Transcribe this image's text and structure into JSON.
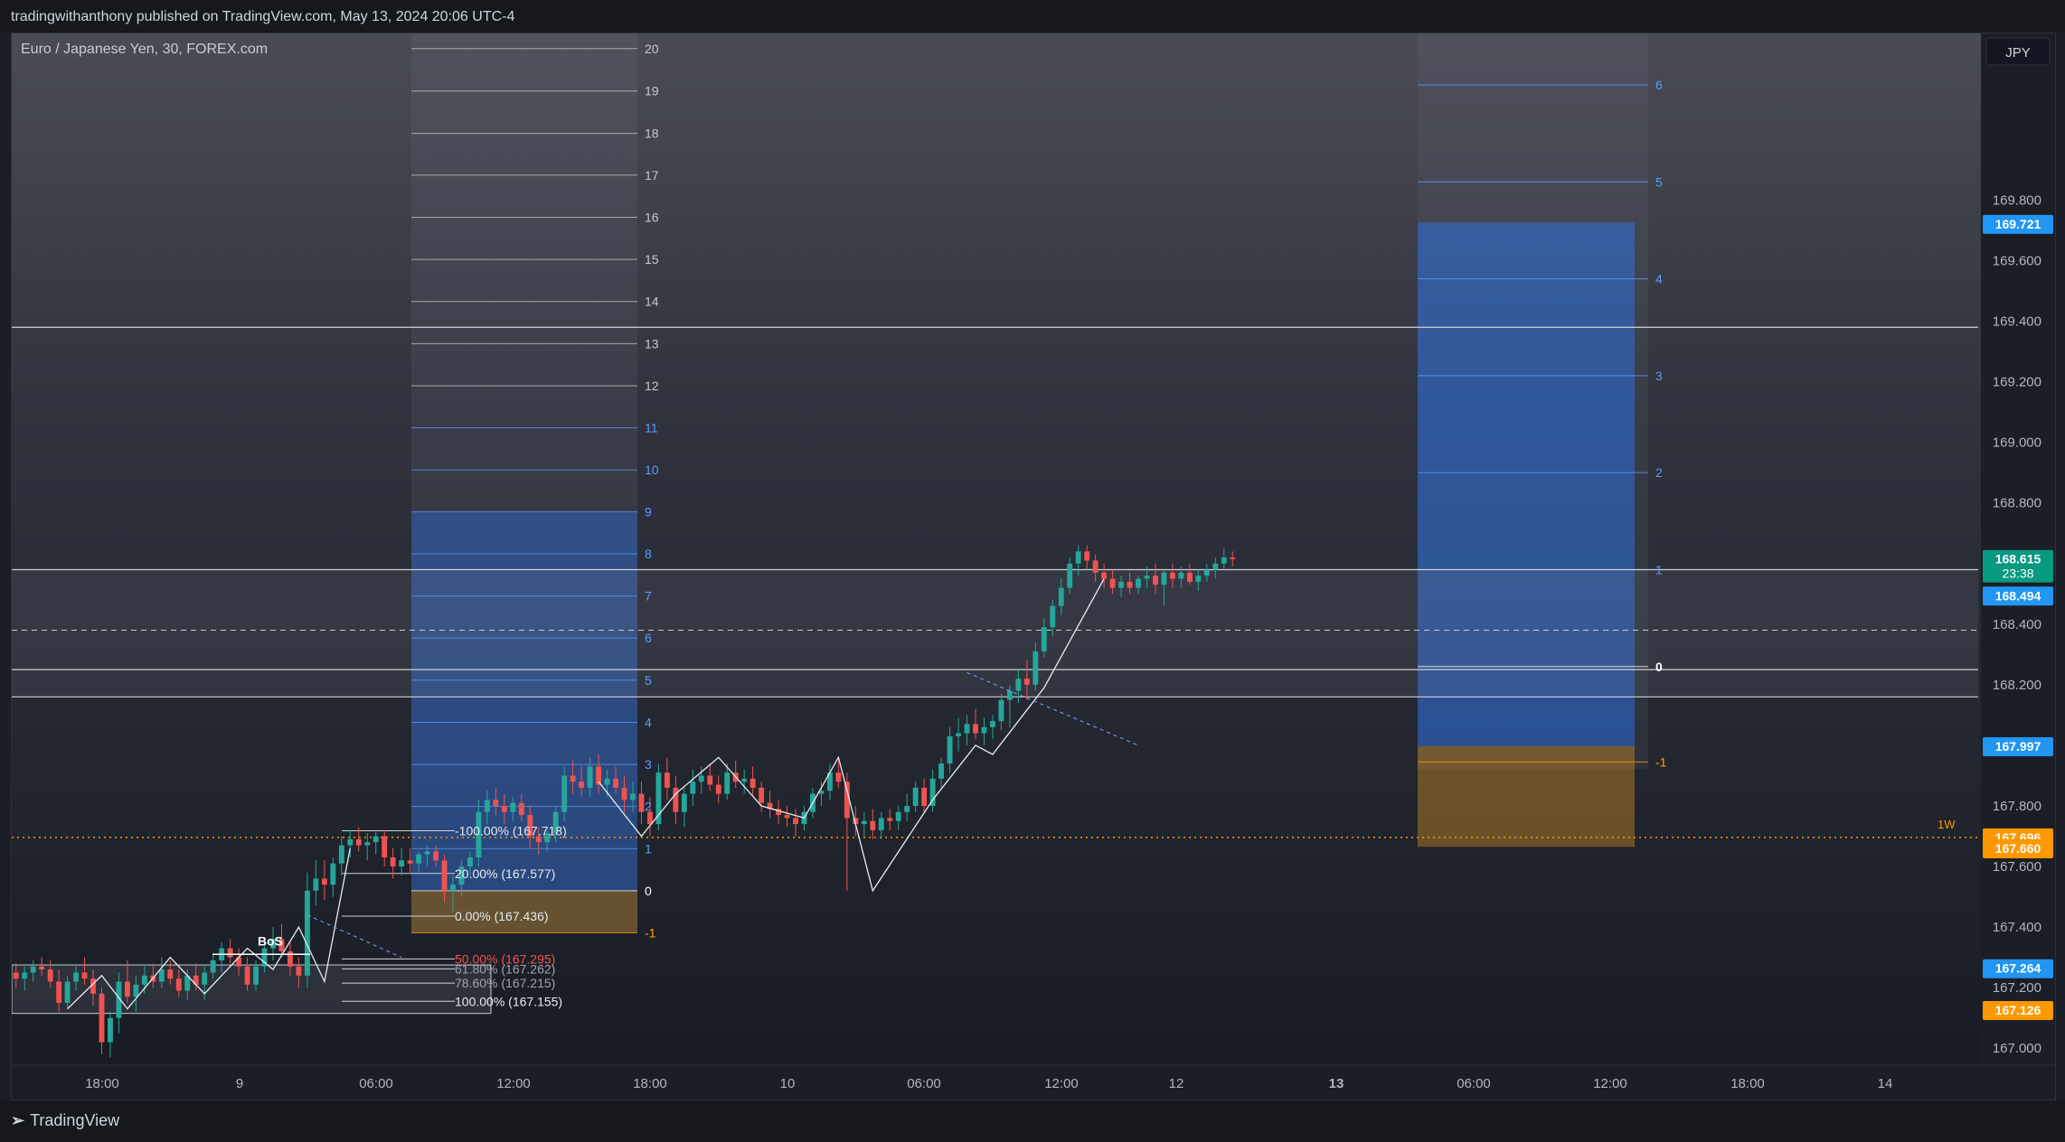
{
  "header": {
    "publish_line": "tradingwithanthony published on TradingView.com, May 13, 2024 20:06 UTC-4"
  },
  "chart_title": "Euro / Japanese Yen, 30, FOREX.com",
  "currency_button": "JPY",
  "brand": "TradingView",
  "colors": {
    "up": "#26a69a",
    "down": "#ef5350",
    "blue_zone": "#2962ff",
    "orange_zone": "#f7a600",
    "bg": "#1b1e26"
  },
  "chart_data": {
    "type": "candlestick",
    "ylim": [
      166.95,
      170.35
    ],
    "price_ticks": [
      "169.800",
      "169.600",
      "169.400",
      "169.200",
      "169.000",
      "168.800",
      "168.400",
      "168.200",
      "167.800",
      "167.600",
      "167.400",
      "167.200",
      "167.000"
    ],
    "price_tick_values": [
      169.8,
      169.6,
      169.4,
      169.2,
      169.0,
      168.8,
      168.4,
      168.2,
      167.8,
      167.6,
      167.4,
      167.2,
      167.0
    ],
    "time_ticks": [
      "18:00",
      "9",
      "06:00",
      "12:00",
      "18:00",
      "10",
      "06:00",
      "12:00",
      "12",
      "13",
      "06:00",
      "12:00",
      "18:00",
      "14"
    ],
    "bold_time_tick": "13",
    "price_badges": [
      {
        "label": "169.721",
        "value": 169.721,
        "color": "#2196f3"
      },
      {
        "label": "168.615",
        "sub": "23:38",
        "value": 168.615,
        "color": "#089981"
      },
      {
        "label": "168.494",
        "value": 168.494,
        "color": "#2196f3"
      },
      {
        "label": "167.997",
        "value": 167.997,
        "color": "#2196f3"
      },
      {
        "label": "167.696",
        "value": 167.696,
        "color": "#ff9800"
      },
      {
        "label": "167.660",
        "value": 167.66,
        "color": "#ff9800"
      },
      {
        "label": "167.264",
        "value": 167.264,
        "color": "#2196f3"
      },
      {
        "label": "167.126",
        "value": 167.126,
        "color": "#ff9800"
      }
    ],
    "horizontal_levels": [
      169.38,
      168.58,
      168.25,
      168.16
    ],
    "weekly_level": {
      "label": "1W",
      "value": 167.696
    },
    "dashed_level": 168.38,
    "left_grid_labels": [
      "20",
      "19",
      "18",
      "17",
      "16",
      "15",
      "14",
      "13",
      "12",
      "11",
      "10",
      "9",
      "8",
      "7",
      "6",
      "5",
      "4",
      "3",
      "2",
      "1",
      "0",
      "-1"
    ],
    "left_grid_prices": [
      170.3,
      170.16,
      170.02,
      169.882,
      169.743,
      169.604,
      169.465,
      169.326,
      169.187,
      169.048,
      168.909,
      168.771,
      168.632,
      168.493,
      168.354,
      168.215,
      168.076,
      167.937,
      167.798,
      167.659,
      167.52,
      167.381
    ],
    "right_grid_labels": [
      "6",
      "5",
      "4",
      "3",
      "2",
      "1",
      "0",
      "-1"
    ],
    "right_grid_prices": [
      170.18,
      169.86,
      169.54,
      169.22,
      168.9,
      168.58,
      168.26,
      167.945
    ],
    "fib_labels": [
      "-100.00% (167.718)",
      "20.00% (167.577)",
      "0.00% (167.436)",
      "50.00% (167.295)",
      "61.80% (167.262)",
      "78.60% (167.215)",
      "100.00% (167.155)"
    ],
    "fib_values": [
      167.718,
      167.577,
      167.436,
      167.295,
      167.262,
      167.215,
      167.155
    ],
    "bos_label": "BoS",
    "candles": [
      [
        167.25,
        167.28,
        167.2,
        167.23
      ],
      [
        167.23,
        167.27,
        167.19,
        167.25
      ],
      [
        167.25,
        167.29,
        167.22,
        167.27
      ],
      [
        167.27,
        167.3,
        167.24,
        167.26
      ],
      [
        167.26,
        167.29,
        167.2,
        167.22
      ],
      [
        167.22,
        167.26,
        167.12,
        167.15
      ],
      [
        167.15,
        167.24,
        167.13,
        167.22
      ],
      [
        167.22,
        167.27,
        167.19,
        167.25
      ],
      [
        167.25,
        167.3,
        167.21,
        167.23
      ],
      [
        167.23,
        167.26,
        167.14,
        167.18
      ],
      [
        167.18,
        167.2,
        166.98,
        167.02
      ],
      [
        167.02,
        167.12,
        166.97,
        167.1
      ],
      [
        167.1,
        167.25,
        167.05,
        167.22
      ],
      [
        167.22,
        167.29,
        167.15,
        167.17
      ],
      [
        167.17,
        167.24,
        167.12,
        167.21
      ],
      [
        167.21,
        167.27,
        167.18,
        167.24
      ],
      [
        167.24,
        167.28,
        167.2,
        167.22
      ],
      [
        167.22,
        167.3,
        167.2,
        167.26
      ],
      [
        167.26,
        167.29,
        167.21,
        167.23
      ],
      [
        167.23,
        167.26,
        167.17,
        167.19
      ],
      [
        167.19,
        167.26,
        167.16,
        167.24
      ],
      [
        167.24,
        167.28,
        167.19,
        167.21
      ],
      [
        167.21,
        167.27,
        167.16,
        167.25
      ],
      [
        167.25,
        167.31,
        167.23,
        167.29
      ],
      [
        167.29,
        167.35,
        167.25,
        167.33
      ],
      [
        167.33,
        167.36,
        167.28,
        167.3
      ],
      [
        167.3,
        167.33,
        167.24,
        167.27
      ],
      [
        167.27,
        167.3,
        167.19,
        167.21
      ],
      [
        167.21,
        167.29,
        167.19,
        167.27
      ],
      [
        167.27,
        167.36,
        167.25,
        167.33
      ],
      [
        167.33,
        167.4,
        167.29,
        167.36
      ],
      [
        167.36,
        167.41,
        167.3,
        167.32
      ],
      [
        167.32,
        167.35,
        167.24,
        167.27
      ],
      [
        167.27,
        167.3,
        167.2,
        167.24
      ],
      [
        167.24,
        167.58,
        167.2,
        167.52
      ],
      [
        167.52,
        167.62,
        167.47,
        167.56
      ],
      [
        167.56,
        167.62,
        167.49,
        167.54
      ],
      [
        167.54,
        167.63,
        167.5,
        167.61
      ],
      [
        167.61,
        167.7,
        167.57,
        167.67
      ],
      [
        167.67,
        167.72,
        167.63,
        167.69
      ],
      [
        167.69,
        167.73,
        167.65,
        167.67
      ],
      [
        167.67,
        167.71,
        167.62,
        167.68
      ],
      [
        167.68,
        167.72,
        167.64,
        167.7
      ],
      [
        167.7,
        167.72,
        167.6,
        167.63
      ],
      [
        167.63,
        167.66,
        167.56,
        167.6
      ],
      [
        167.6,
        167.66,
        167.57,
        167.62
      ],
      [
        167.62,
        167.66,
        167.58,
        167.61
      ],
      [
        167.61,
        167.65,
        167.58,
        167.64
      ],
      [
        167.64,
        167.67,
        167.6,
        167.65
      ],
      [
        167.65,
        167.67,
        167.6,
        167.62
      ],
      [
        167.62,
        167.64,
        167.48,
        167.52
      ],
      [
        167.52,
        167.57,
        167.45,
        167.54
      ],
      [
        167.54,
        167.62,
        167.5,
        167.6
      ],
      [
        167.6,
        167.65,
        167.57,
        167.63
      ],
      [
        167.63,
        167.82,
        167.6,
        167.78
      ],
      [
        167.78,
        167.85,
        167.74,
        167.82
      ],
      [
        167.82,
        167.86,
        167.77,
        167.8
      ],
      [
        167.8,
        167.84,
        167.74,
        167.78
      ],
      [
        167.78,
        167.83,
        167.75,
        167.81
      ],
      [
        167.81,
        167.84,
        167.75,
        167.77
      ],
      [
        167.77,
        167.8,
        167.66,
        167.7
      ],
      [
        167.7,
        167.73,
        167.64,
        167.68
      ],
      [
        167.68,
        167.72,
        167.65,
        167.71
      ],
      [
        167.71,
        167.8,
        167.68,
        167.78
      ],
      [
        167.78,
        167.93,
        167.75,
        167.9
      ],
      [
        167.9,
        167.95,
        167.84,
        167.88
      ],
      [
        167.88,
        167.93,
        167.83,
        167.86
      ],
      [
        167.86,
        167.96,
        167.83,
        167.93
      ],
      [
        167.93,
        167.97,
        167.84,
        167.87
      ],
      [
        167.87,
        167.92,
        167.83,
        167.89
      ],
      [
        167.89,
        167.93,
        167.84,
        167.86
      ],
      [
        167.86,
        167.9,
        167.78,
        167.82
      ],
      [
        167.82,
        167.88,
        167.78,
        167.84
      ],
      [
        167.84,
        167.88,
        167.74,
        167.78
      ],
      [
        167.78,
        167.83,
        167.7,
        167.74
      ],
      [
        167.74,
        167.94,
        167.72,
        167.91
      ],
      [
        167.91,
        167.96,
        167.82,
        167.86
      ],
      [
        167.86,
        167.9,
        167.74,
        167.78
      ],
      [
        167.78,
        167.86,
        167.73,
        167.84
      ],
      [
        167.84,
        167.92,
        167.8,
        167.88
      ],
      [
        167.88,
        167.93,
        167.84,
        167.9
      ],
      [
        167.9,
        167.94,
        167.85,
        167.87
      ],
      [
        167.87,
        167.9,
        167.81,
        167.84
      ],
      [
        167.84,
        167.94,
        167.82,
        167.91
      ],
      [
        167.91,
        167.95,
        167.86,
        167.88
      ],
      [
        167.88,
        167.92,
        167.84,
        167.89
      ],
      [
        167.89,
        167.93,
        167.83,
        167.86
      ],
      [
        167.86,
        167.88,
        167.78,
        167.81
      ],
      [
        167.81,
        167.85,
        167.76,
        167.79
      ],
      [
        167.79,
        167.82,
        167.74,
        167.77
      ],
      [
        167.77,
        167.8,
        167.73,
        167.76
      ],
      [
        167.76,
        167.79,
        167.7,
        167.74
      ],
      [
        167.74,
        167.8,
        167.72,
        167.78
      ],
      [
        167.78,
        167.86,
        167.76,
        167.84
      ],
      [
        167.84,
        167.88,
        167.8,
        167.85
      ],
      [
        167.85,
        167.94,
        167.82,
        167.91
      ],
      [
        167.91,
        167.95,
        167.86,
        167.88
      ],
      [
        167.88,
        167.91,
        167.52,
        167.76
      ],
      [
        167.76,
        167.8,
        167.7,
        167.74
      ],
      [
        167.74,
        167.78,
        167.7,
        167.75
      ],
      [
        167.75,
        167.79,
        167.69,
        167.72
      ],
      [
        167.72,
        167.78,
        167.69,
        167.76
      ],
      [
        167.76,
        167.79,
        167.72,
        167.75
      ],
      [
        167.75,
        167.8,
        167.72,
        167.78
      ],
      [
        167.78,
        167.84,
        167.75,
        167.8
      ],
      [
        167.8,
        167.88,
        167.78,
        167.86
      ],
      [
        167.86,
        167.89,
        167.78,
        167.8
      ],
      [
        167.8,
        167.92,
        167.78,
        167.89
      ],
      [
        167.89,
        167.96,
        167.86,
        167.94
      ],
      [
        167.94,
        168.06,
        167.91,
        168.03
      ],
      [
        168.03,
        168.09,
        167.98,
        168.04
      ],
      [
        168.04,
        168.1,
        168.0,
        168.07
      ],
      [
        168.07,
        168.12,
        168.02,
        168.04
      ],
      [
        168.04,
        168.09,
        168.0,
        168.06
      ],
      [
        168.06,
        168.1,
        168.02,
        168.08
      ],
      [
        168.08,
        168.17,
        168.05,
        168.15
      ],
      [
        168.15,
        168.2,
        168.06,
        168.18
      ],
      [
        168.18,
        168.25,
        168.14,
        168.22
      ],
      [
        168.22,
        168.28,
        168.15,
        168.2
      ],
      [
        168.2,
        168.34,
        168.18,
        168.31
      ],
      [
        168.31,
        168.42,
        168.29,
        168.39
      ],
      [
        168.39,
        168.48,
        168.36,
        168.46
      ],
      [
        168.46,
        168.55,
        168.43,
        168.52
      ],
      [
        168.52,
        168.62,
        168.5,
        168.6
      ],
      [
        168.6,
        168.66,
        168.56,
        168.64
      ],
      [
        168.64,
        168.66,
        168.58,
        168.61
      ],
      [
        168.61,
        168.63,
        168.54,
        168.57
      ],
      [
        168.57,
        168.6,
        168.52,
        168.55
      ],
      [
        168.55,
        168.58,
        168.5,
        168.52
      ],
      [
        168.52,
        168.56,
        168.49,
        168.54
      ],
      [
        168.54,
        168.57,
        168.5,
        168.52
      ],
      [
        168.52,
        168.56,
        168.5,
        168.55
      ],
      [
        168.55,
        168.59,
        168.52,
        168.56
      ],
      [
        168.56,
        168.6,
        168.5,
        168.53
      ],
      [
        168.53,
        168.58,
        168.46,
        168.57
      ],
      [
        168.57,
        168.6,
        168.52,
        168.55
      ],
      [
        168.55,
        168.59,
        168.52,
        168.57
      ],
      [
        168.57,
        168.6,
        168.53,
        168.54
      ],
      [
        168.54,
        168.58,
        168.51,
        168.56
      ],
      [
        168.56,
        168.6,
        168.54,
        168.58
      ],
      [
        168.58,
        168.62,
        168.55,
        168.6
      ],
      [
        168.6,
        168.65,
        168.58,
        168.62
      ],
      [
        168.62,
        168.64,
        168.59,
        168.615
      ]
    ]
  }
}
